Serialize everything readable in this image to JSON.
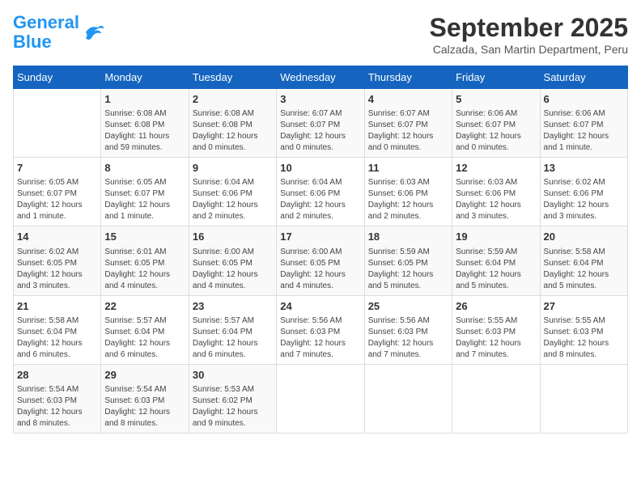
{
  "header": {
    "logo_line1": "General",
    "logo_line2": "Blue",
    "month": "September 2025",
    "location": "Calzada, San Martin Department, Peru"
  },
  "days_of_week": [
    "Sunday",
    "Monday",
    "Tuesday",
    "Wednesday",
    "Thursday",
    "Friday",
    "Saturday"
  ],
  "weeks": [
    [
      {
        "day": "",
        "info": ""
      },
      {
        "day": "1",
        "info": "Sunrise: 6:08 AM\nSunset: 6:08 PM\nDaylight: 11 hours\nand 59 minutes."
      },
      {
        "day": "2",
        "info": "Sunrise: 6:08 AM\nSunset: 6:08 PM\nDaylight: 12 hours\nand 0 minutes."
      },
      {
        "day": "3",
        "info": "Sunrise: 6:07 AM\nSunset: 6:07 PM\nDaylight: 12 hours\nand 0 minutes."
      },
      {
        "day": "4",
        "info": "Sunrise: 6:07 AM\nSunset: 6:07 PM\nDaylight: 12 hours\nand 0 minutes."
      },
      {
        "day": "5",
        "info": "Sunrise: 6:06 AM\nSunset: 6:07 PM\nDaylight: 12 hours\nand 0 minutes."
      },
      {
        "day": "6",
        "info": "Sunrise: 6:06 AM\nSunset: 6:07 PM\nDaylight: 12 hours\nand 1 minute."
      }
    ],
    [
      {
        "day": "7",
        "info": "Sunrise: 6:05 AM\nSunset: 6:07 PM\nDaylight: 12 hours\nand 1 minute."
      },
      {
        "day": "8",
        "info": "Sunrise: 6:05 AM\nSunset: 6:07 PM\nDaylight: 12 hours\nand 1 minute."
      },
      {
        "day": "9",
        "info": "Sunrise: 6:04 AM\nSunset: 6:06 PM\nDaylight: 12 hours\nand 2 minutes."
      },
      {
        "day": "10",
        "info": "Sunrise: 6:04 AM\nSunset: 6:06 PM\nDaylight: 12 hours\nand 2 minutes."
      },
      {
        "day": "11",
        "info": "Sunrise: 6:03 AM\nSunset: 6:06 PM\nDaylight: 12 hours\nand 2 minutes."
      },
      {
        "day": "12",
        "info": "Sunrise: 6:03 AM\nSunset: 6:06 PM\nDaylight: 12 hours\nand 3 minutes."
      },
      {
        "day": "13",
        "info": "Sunrise: 6:02 AM\nSunset: 6:06 PM\nDaylight: 12 hours\nand 3 minutes."
      }
    ],
    [
      {
        "day": "14",
        "info": "Sunrise: 6:02 AM\nSunset: 6:05 PM\nDaylight: 12 hours\nand 3 minutes."
      },
      {
        "day": "15",
        "info": "Sunrise: 6:01 AM\nSunset: 6:05 PM\nDaylight: 12 hours\nand 4 minutes."
      },
      {
        "day": "16",
        "info": "Sunrise: 6:00 AM\nSunset: 6:05 PM\nDaylight: 12 hours\nand 4 minutes."
      },
      {
        "day": "17",
        "info": "Sunrise: 6:00 AM\nSunset: 6:05 PM\nDaylight: 12 hours\nand 4 minutes."
      },
      {
        "day": "18",
        "info": "Sunrise: 5:59 AM\nSunset: 6:05 PM\nDaylight: 12 hours\nand 5 minutes."
      },
      {
        "day": "19",
        "info": "Sunrise: 5:59 AM\nSunset: 6:04 PM\nDaylight: 12 hours\nand 5 minutes."
      },
      {
        "day": "20",
        "info": "Sunrise: 5:58 AM\nSunset: 6:04 PM\nDaylight: 12 hours\nand 5 minutes."
      }
    ],
    [
      {
        "day": "21",
        "info": "Sunrise: 5:58 AM\nSunset: 6:04 PM\nDaylight: 12 hours\nand 6 minutes."
      },
      {
        "day": "22",
        "info": "Sunrise: 5:57 AM\nSunset: 6:04 PM\nDaylight: 12 hours\nand 6 minutes."
      },
      {
        "day": "23",
        "info": "Sunrise: 5:57 AM\nSunset: 6:04 PM\nDaylight: 12 hours\nand 6 minutes."
      },
      {
        "day": "24",
        "info": "Sunrise: 5:56 AM\nSunset: 6:03 PM\nDaylight: 12 hours\nand 7 minutes."
      },
      {
        "day": "25",
        "info": "Sunrise: 5:56 AM\nSunset: 6:03 PM\nDaylight: 12 hours\nand 7 minutes."
      },
      {
        "day": "26",
        "info": "Sunrise: 5:55 AM\nSunset: 6:03 PM\nDaylight: 12 hours\nand 7 minutes."
      },
      {
        "day": "27",
        "info": "Sunrise: 5:55 AM\nSunset: 6:03 PM\nDaylight: 12 hours\nand 8 minutes."
      }
    ],
    [
      {
        "day": "28",
        "info": "Sunrise: 5:54 AM\nSunset: 6:03 PM\nDaylight: 12 hours\nand 8 minutes."
      },
      {
        "day": "29",
        "info": "Sunrise: 5:54 AM\nSunset: 6:03 PM\nDaylight: 12 hours\nand 8 minutes."
      },
      {
        "day": "30",
        "info": "Sunrise: 5:53 AM\nSunset: 6:02 PM\nDaylight: 12 hours\nand 9 minutes."
      },
      {
        "day": "",
        "info": ""
      },
      {
        "day": "",
        "info": ""
      },
      {
        "day": "",
        "info": ""
      },
      {
        "day": "",
        "info": ""
      }
    ]
  ]
}
